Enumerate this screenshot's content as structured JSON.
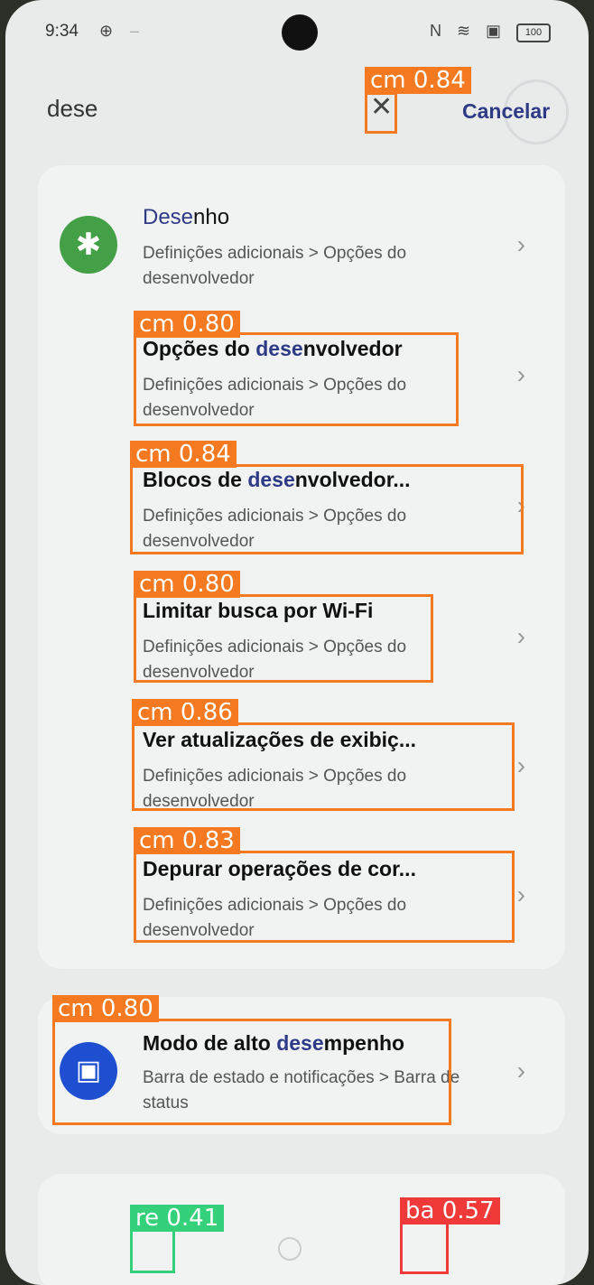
{
  "status_bar": {
    "time": "9:34",
    "battery": "100"
  },
  "search": {
    "query": "dese",
    "clear_icon": "close-icon",
    "cancel_label": "Cancelar"
  },
  "results": [
    {
      "title_pre": "",
      "title_hl": "Dese",
      "title_post": "nho",
      "subtitle": "Definições adicionais > Opções do desenvolvedor",
      "icon": "gear-icon"
    },
    {
      "title_pre": "Opções do ",
      "title_hl": "dese",
      "title_post": "nvolvedor",
      "subtitle": "Definições adicionais > Opções do desenvolvedor"
    },
    {
      "title_pre": "Blocos de ",
      "title_hl": "dese",
      "title_post": "nvolvedor...",
      "subtitle": "Definições adicionais > Opções do desenvolvedor"
    },
    {
      "title_pre": "Limitar busca por Wi-Fi",
      "title_hl": "",
      "title_post": "",
      "subtitle": "Definições adicionais > Opções do desenvolvedor"
    },
    {
      "title_pre": "Ver atualizações de exibiç...",
      "title_hl": "",
      "title_post": "",
      "subtitle": "Definições adicionais > Opções do desenvolvedor"
    },
    {
      "title_pre": "Depurar operações de cor...",
      "title_hl": "",
      "title_post": "",
      "subtitle": "Definições adicionais > Opções do desenvolvedor"
    },
    {
      "title_pre": "Modo de alto ",
      "title_hl": "dese",
      "title_post": "mpenho",
      "subtitle": "Barra de estado e notificações > Barra de status",
      "icon": "notification-bar-icon"
    }
  ],
  "detections": [
    {
      "label": "cm 0.84"
    },
    {
      "label": "cm 0.80"
    },
    {
      "label": "cm 0.84"
    },
    {
      "label": "cm 0.80"
    },
    {
      "label": "cm 0.86"
    },
    {
      "label": "cm 0.83"
    },
    {
      "label": "cm 0.80"
    },
    {
      "label": "re 0.41"
    },
    {
      "label": "ba 0.57"
    }
  ],
  "colors": {
    "highlight": "#2d3a86",
    "detection_orange": "#f47920",
    "detection_green": "#35d17a",
    "detection_red": "#f03a3a"
  }
}
